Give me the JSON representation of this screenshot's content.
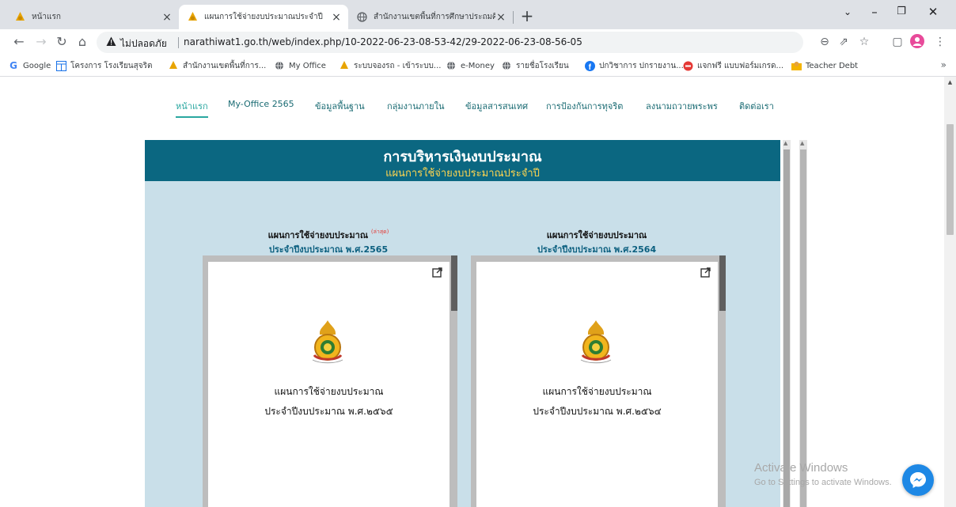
{
  "browser": {
    "tabs": [
      {
        "title": "หน้าแรก",
        "active": false
      },
      {
        "title": "แผนการใช้จ่ายงบประมาณประจำปี",
        "active": true
      },
      {
        "title": "สำนักงานเขตพื้นที่การศึกษาประถมศึกษ",
        "active": false
      }
    ],
    "address": {
      "security_label": "ไม่ปลอดภัย",
      "url": "narathiwat1.go.th/web/index.php/10-2022-06-23-08-53-42/29-2022-06-23-08-56-05"
    },
    "bookmarks": [
      {
        "label": "Google",
        "icon": "google-icon"
      },
      {
        "label": "โครงการ โรงเรียนสุจริต",
        "icon": "table-icon"
      },
      {
        "label": "สำนักงานเขตพื้นที่การ...",
        "icon": "obec-icon"
      },
      {
        "label": "My Office",
        "icon": "globe-icon"
      },
      {
        "label": "ระบบจองรถ - เข้าระบบ...",
        "icon": "obec-icon"
      },
      {
        "label": "e-Money",
        "icon": "globe-icon"
      },
      {
        "label": "รายชื่อโรงเรียน",
        "icon": "globe-icon"
      },
      {
        "label": "ปกวิชาการ ปกรายงาน...",
        "icon": "facebook-icon"
      },
      {
        "label": "แจกฟรี แบบฟอร์มเกรด...",
        "icon": "red-circle-icon"
      },
      {
        "label": "Teacher Debt",
        "icon": "teacher-icon"
      }
    ],
    "bookmarks_more": "»"
  },
  "site": {
    "nav": [
      {
        "label": "หน้าแรก",
        "active": true
      },
      {
        "label": "My-Office 2565",
        "active": false
      },
      {
        "label": "ข้อมูลพื้นฐาน",
        "active": false
      },
      {
        "label": "กลุ่มงานภายใน",
        "active": false
      },
      {
        "label": "ข้อมูลสารสนเทศ",
        "active": false
      },
      {
        "label": "การป้องกันการทุจริต",
        "active": false
      },
      {
        "label": "ลงนามถวายพระพร",
        "active": false
      },
      {
        "label": "ติดต่อเรา",
        "active": false
      }
    ],
    "panel": {
      "heading": "การบริหารเงินงบประมาณ",
      "subheading": "แผนการใช้จ่ายงบประมาณประจำปี"
    },
    "documents": [
      {
        "title": "แผนการใช้จ่ายงบประมาณ",
        "badge": "(ล่าสุด)",
        "subtitle": "ประจำปีงบประมาณ พ.ศ.2565",
        "page_line1": "แผนการใช้จ่ายงบประมาณ",
        "page_line2": "ประจำปีงบประมาณ พ.ศ.๒๕๖๕"
      },
      {
        "title": "แผนการใช้จ่ายงบประมาณ",
        "badge": "",
        "subtitle": "ประจำปีงบประมาณ พ.ศ.2564",
        "page_line1": "แผนการใช้จ่ายงบประมาณ",
        "page_line2": "ประจำปีงบประมาณ พ.ศ.๒๕๖๔"
      }
    ]
  },
  "watermark": {
    "line1": "Activate Windows",
    "line2": "Go to Settings to activate Windows."
  },
  "colors": {
    "panel_header": "#0b6781",
    "panel_body": "#c9dfe9",
    "subheading": "#ffd54f",
    "nav_text": "#1a6b73",
    "latest_badge": "#e53935"
  }
}
